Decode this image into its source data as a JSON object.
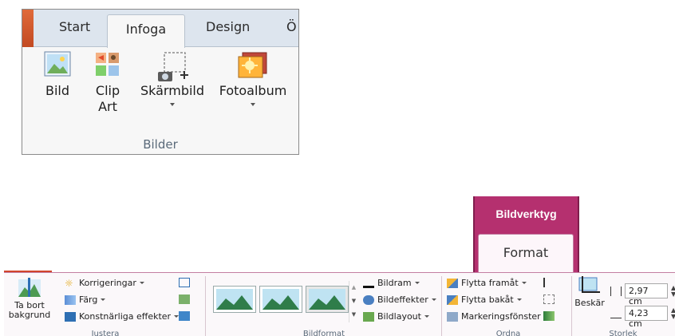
{
  "top_ribbon": {
    "tabs": {
      "start": "Start",
      "infoga": "Infoga",
      "design": "Design",
      "more": "Ö"
    },
    "buttons": {
      "bild": "Bild",
      "clip_art": "Clip Art",
      "skarmbild": "Skärmbild",
      "fotoalbum": "Fotoalbum"
    },
    "group_label": "Bilder"
  },
  "picture_tools": {
    "title": "Bildverktyg",
    "tab": "Format"
  },
  "bottom_ribbon": {
    "justera": {
      "remove_background": "Ta bort bakgrund",
      "korrigeringar": "Korrigeringar",
      "farg": "Färg",
      "konstnarliga": "Konstnärliga effekter",
      "label": "Justera"
    },
    "bildformat": {
      "bildram": "Bildram",
      "bildeffekter": "Bildeffekter",
      "bildlayout": "Bildlayout",
      "label": "Bildformat"
    },
    "ordna": {
      "flytta_framat": "Flytta framåt",
      "flytta_bakat": "Flytta bakåt",
      "markeringsfonster": "Markeringsfönster",
      "label": "Ordna"
    },
    "storlek": {
      "beskar": "Beskär",
      "height": "2,97 cm",
      "width": "4,23 cm",
      "label": "Storlek"
    }
  },
  "colors": {
    "contextual_tab": "#b5306f",
    "file_tab": "#d2452c"
  }
}
